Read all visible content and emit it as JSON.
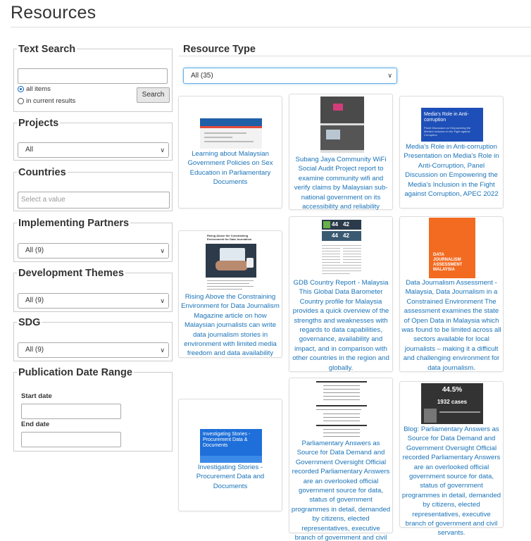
{
  "page": {
    "title": "Resources"
  },
  "filters": {
    "text_search": {
      "legend": "Text Search",
      "input_value": "",
      "radio_all": "all items",
      "radio_current": "in current results",
      "search_button": "Search"
    },
    "projects": {
      "legend": "Projects",
      "selected": "All"
    },
    "countries": {
      "legend": "Countries",
      "placeholder": "Select a value"
    },
    "implementing_partners": {
      "legend": "Implementing Partners",
      "selected": "All (9)"
    },
    "development_themes": {
      "legend": "Development Themes",
      "selected": "All (9)"
    },
    "sdg": {
      "legend": "SDG",
      "selected": "All (9)"
    },
    "publication_date": {
      "legend": "Publication Date Range",
      "start_label": "Start date",
      "end_label": "End date"
    }
  },
  "resource_type": {
    "legend": "Resource Type",
    "selected": "All (35)"
  },
  "thumbnails": {
    "anti_corruption": {
      "title": "Media's Role in Anti-corruption",
      "subtitle": "Panel Discussion on Empowering the Media's Inclusion in the Fight against Corruption"
    },
    "rising_above": {
      "title": "Rising Above the Constraining Environment for Data Journalism"
    },
    "gdb": {
      "scores": [
        "44",
        "42",
        "44",
        "42"
      ]
    },
    "dja": {
      "title": "DATA JOURNALISM ASSESSMENT MALAYSIA"
    },
    "blog": {
      "percent": "44.5%",
      "cases": "1932 cases"
    },
    "investigating": {
      "title": "Investigating Stories - Procurement Data & Documents"
    }
  },
  "resources": [
    {
      "text": "Learning about Malaysian Government Policies on Sex Education in Parliamentary Documents"
    },
    {
      "text": "Subang Jaya Community WiFi Social Audit Project report to examine community wifi and verify claims by Malaysian sub-national government on its accessibility and reliability"
    },
    {
      "text": "Media's Role in Anti-corruption Presentation on Media's Role in Anti-Corruption, Panel Discussion on Empowering the Media's Inclusion in the Fight against Corruption, APEC 2022"
    },
    {
      "text": "Rising Above the Constraining Environment for Data Journalism Magazine article on how Malaysian journalists can write data journalism stories in environment with limited media freedom and data availability"
    },
    {
      "text": "GDB Country Report - Malaysia This Global Data Barometer Country profile for Malaysia provides a quick overview of the strengths and weaknesses with regards to data capabilities, governance, availability and impact, and in comparison with other countries in the region and globally."
    },
    {
      "text": "Data Journalism Assessment - Malaysia, Data Journalism in a Constrained Environment The assessment examines the state of Open Data in Malaysia which was found to be limited across all sectors available for local journalists – making it a difficult and challenging environment for data journalism."
    },
    {
      "text": "Investigating Stories - Procurement Data and Documents"
    },
    {
      "text": "Parliamentary Answers as Source for Data Demand and Government Oversight Official recorded Parliamentary Answers are an overlooked official government source for data, status of government programmes in detail, demanded by citizens, elected representatives, executive branch of government and civil servants."
    },
    {
      "text": "Blog: Parliamentary Answers as Source for Data Demand and Government Oversight Official recorded Parliamentary Answers are an overlooked official government source for data, status of government programmes in detail, demanded by citizens, elected representatives, executive branch of government and civil servants."
    }
  ],
  "icons": {
    "dropdown": "chevron-down-icon",
    "radio": "radio-icon"
  },
  "colors": {
    "link": "#1a73b8",
    "focus": "#66afe9",
    "dja_orange": "#f26b21"
  }
}
